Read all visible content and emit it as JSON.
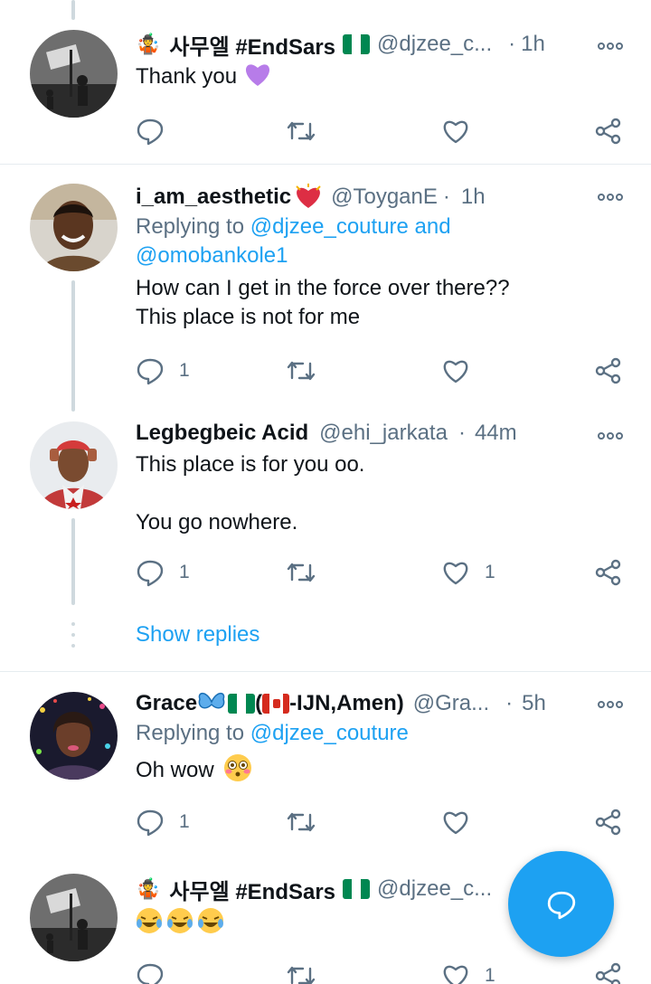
{
  "colors": {
    "accent": "#1da1f2",
    "secondary_text": "#5b7083",
    "line": "#cfd9de",
    "heart_purple": "#b77ce9"
  },
  "tweets": [
    {
      "name": "사무엘 #EndSars",
      "name_prefix_icon": "juggler-emoji-icon",
      "flag": "nigeria-flag",
      "handle": "@djzee_c...",
      "dot": "·",
      "time": "1h",
      "body_lines": [
        "Thank you"
      ],
      "body_emoji": "purple-heart-emoji",
      "reply_count": "",
      "like_count": ""
    },
    {
      "name": "i_am_aesthetic",
      "name_suffix_icon": "heart-exclamation-emoji",
      "handle": "@ToyganE",
      "dot": "·",
      "time": "1h",
      "replying_prefix": "Replying to ",
      "replying_line1_mention": "@djzee_couture",
      "replying_and": " and",
      "replying_line2_mention": "@omobankole1",
      "body_lines": [
        "How can I get in the force over there??",
        "This place is not for me"
      ],
      "reply_count": "1",
      "like_count": ""
    },
    {
      "name": "Legbegbeic Acid",
      "handle": "@ehi_jarkata",
      "dot": "·",
      "time": "44m",
      "body_lines": [
        "This place is for you oo.",
        "",
        "You go nowhere."
      ],
      "reply_count": "1",
      "like_count": "1"
    },
    {
      "name_part1": "Grace",
      "name_part2": "(",
      "name_part3": "-IJN,Amen)",
      "handle": "@Gra...",
      "dot": "·",
      "time": "5h",
      "replying_prefix": "Replying to ",
      "replying_line1_mention": "@djzee_couture",
      "body_lines": [
        "Oh wow"
      ],
      "body_emoji": "flushed-face-emoji",
      "reply_count": "1",
      "like_count": ""
    },
    {
      "name": "사무엘 #EndSars",
      "name_prefix_icon": "juggler-emoji-icon",
      "flag": "nigeria-flag",
      "handle": "@djzee_c...",
      "dot": "·",
      "body_emoji": "laughing-tears-emoji x3",
      "reply_count": "",
      "like_count": "1"
    }
  ],
  "show_replies_label": "Show replies",
  "fab_icon": "reply-bubble-icon"
}
